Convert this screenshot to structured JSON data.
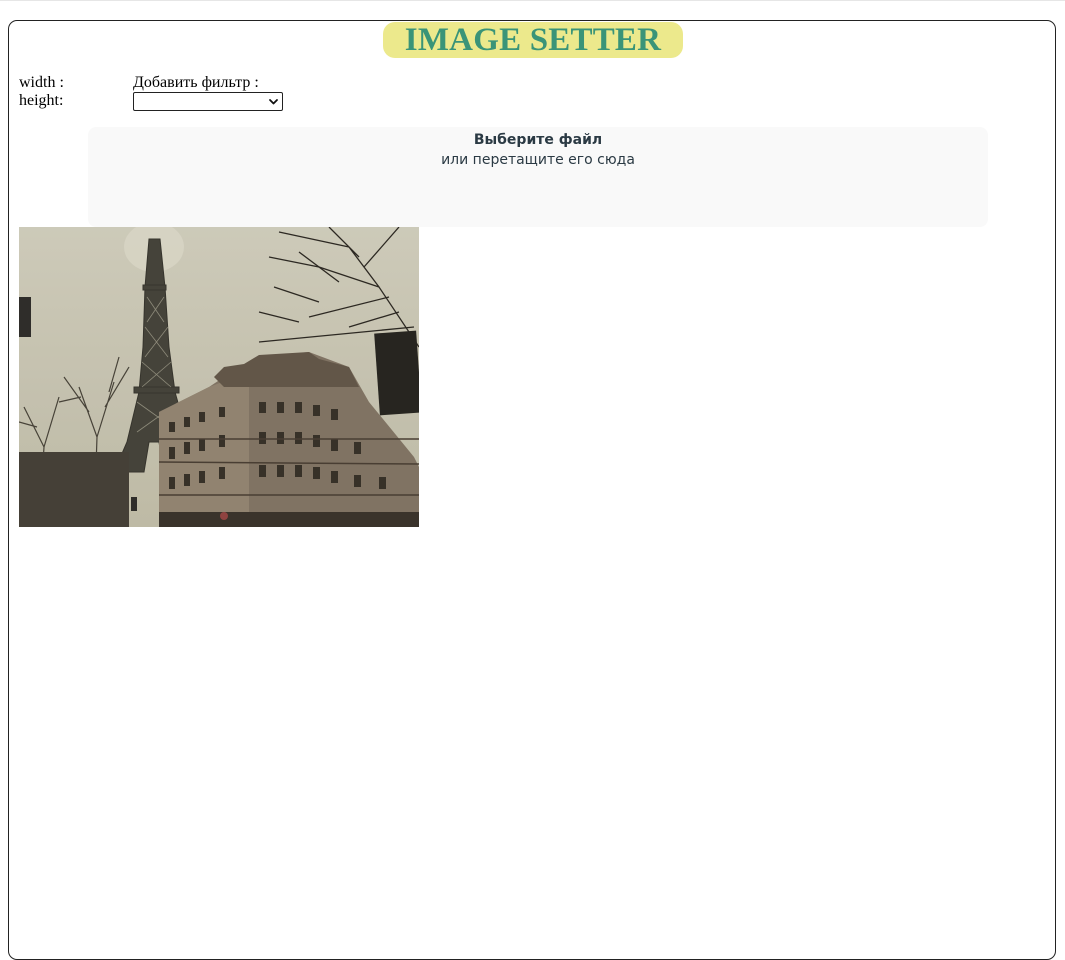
{
  "header": {
    "title": "IMAGE SETTER"
  },
  "controls": {
    "width_label": "width :",
    "height_label": "height:",
    "filter_label": "Добавить фильтр :",
    "filter_selected": ""
  },
  "dropzone": {
    "title": "Выберите файл",
    "subtitle": "или перетащите его сюда"
  },
  "colors": {
    "title_bg": "#ece98c",
    "title_text": "#3a9478",
    "dropzone_bg": "#f9f9f9"
  },
  "icons": {
    "select_arrow": "chevron-down-icon"
  }
}
